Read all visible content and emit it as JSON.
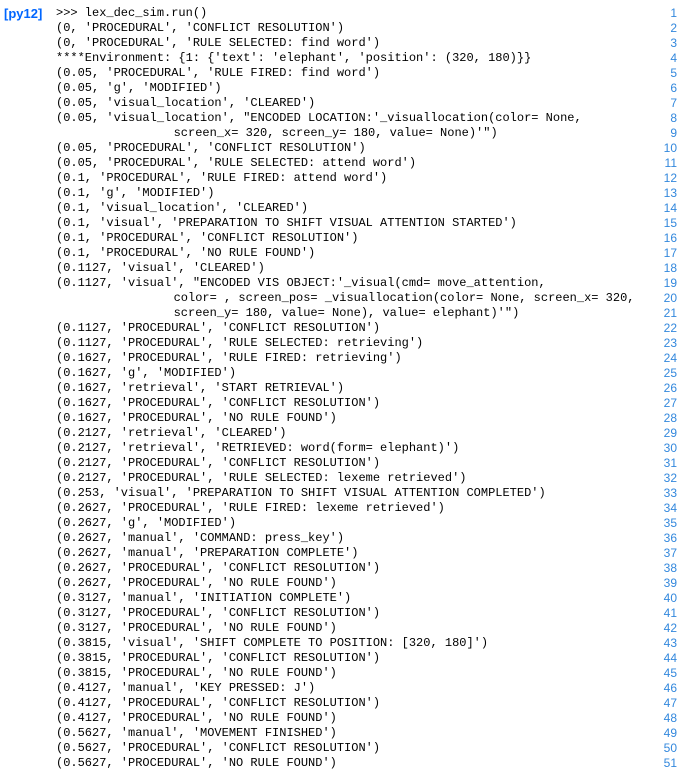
{
  "label": "[py12]",
  "lines": [
    {
      "n": "1",
      "t": ">>> lex_dec_sim.run()"
    },
    {
      "n": "2",
      "t": "(0, 'PROCEDURAL', 'CONFLICT RESOLUTION')"
    },
    {
      "n": "3",
      "t": "(0, 'PROCEDURAL', 'RULE SELECTED: find word')"
    },
    {
      "n": "4",
      "t": "****Environment: {1: {'text': 'elephant', 'position': (320, 180)}}"
    },
    {
      "n": "5",
      "t": "(0.05, 'PROCEDURAL', 'RULE FIRED: find word')"
    },
    {
      "n": "6",
      "t": "(0.05, 'g', 'MODIFIED')"
    },
    {
      "n": "7",
      "t": "(0.05, 'visual_location', 'CLEARED')"
    },
    {
      "n": "8",
      "t": "(0.05, 'visual_location', \"ENCODED LOCATION:'_visuallocation(color= None,"
    },
    {
      "n": "9",
      "t": "        screen_x= 320, screen_y= 180, value= None)'\")",
      "cont": true
    },
    {
      "n": "10",
      "t": "(0.05, 'PROCEDURAL', 'CONFLICT RESOLUTION')"
    },
    {
      "n": "11",
      "t": "(0.05, 'PROCEDURAL', 'RULE SELECTED: attend word')"
    },
    {
      "n": "12",
      "t": "(0.1, 'PROCEDURAL', 'RULE FIRED: attend word')"
    },
    {
      "n": "13",
      "t": "(0.1, 'g', 'MODIFIED')"
    },
    {
      "n": "14",
      "t": "(0.1, 'visual_location', 'CLEARED')"
    },
    {
      "n": "15",
      "t": "(0.1, 'visual', 'PREPARATION TO SHIFT VISUAL ATTENTION STARTED')"
    },
    {
      "n": "16",
      "t": "(0.1, 'PROCEDURAL', 'CONFLICT RESOLUTION')"
    },
    {
      "n": "17",
      "t": "(0.1, 'PROCEDURAL', 'NO RULE FOUND')"
    },
    {
      "n": "18",
      "t": "(0.1127, 'visual', 'CLEARED')"
    },
    {
      "n": "19",
      "t": "(0.1127, 'visual', \"ENCODED VIS OBJECT:'_visual(cmd= move_attention,"
    },
    {
      "n": "20",
      "t": "        color= , screen_pos= _visuallocation(color= None, screen_x= 320,",
      "cont": true
    },
    {
      "n": "21",
      "t": "        screen_y= 180, value= None), value= elephant)'\")",
      "cont": true
    },
    {
      "n": "22",
      "t": "(0.1127, 'PROCEDURAL', 'CONFLICT RESOLUTION')"
    },
    {
      "n": "23",
      "t": "(0.1127, 'PROCEDURAL', 'RULE SELECTED: retrieving')"
    },
    {
      "n": "24",
      "t": "(0.1627, 'PROCEDURAL', 'RULE FIRED: retrieving')"
    },
    {
      "n": "25",
      "t": "(0.1627, 'g', 'MODIFIED')"
    },
    {
      "n": "26",
      "t": "(0.1627, 'retrieval', 'START RETRIEVAL')"
    },
    {
      "n": "27",
      "t": "(0.1627, 'PROCEDURAL', 'CONFLICT RESOLUTION')"
    },
    {
      "n": "28",
      "t": "(0.1627, 'PROCEDURAL', 'NO RULE FOUND')"
    },
    {
      "n": "29",
      "t": "(0.2127, 'retrieval', 'CLEARED')"
    },
    {
      "n": "30",
      "t": "(0.2127, 'retrieval', 'RETRIEVED: word(form= elephant)')"
    },
    {
      "n": "31",
      "t": "(0.2127, 'PROCEDURAL', 'CONFLICT RESOLUTION')"
    },
    {
      "n": "32",
      "t": "(0.2127, 'PROCEDURAL', 'RULE SELECTED: lexeme retrieved')"
    },
    {
      "n": "33",
      "t": "(0.253, 'visual', 'PREPARATION TO SHIFT VISUAL ATTENTION COMPLETED')"
    },
    {
      "n": "34",
      "t": "(0.2627, 'PROCEDURAL', 'RULE FIRED: lexeme retrieved')"
    },
    {
      "n": "35",
      "t": "(0.2627, 'g', 'MODIFIED')"
    },
    {
      "n": "36",
      "t": "(0.2627, 'manual', 'COMMAND: press_key')"
    },
    {
      "n": "37",
      "t": "(0.2627, 'manual', 'PREPARATION COMPLETE')"
    },
    {
      "n": "38",
      "t": "(0.2627, 'PROCEDURAL', 'CONFLICT RESOLUTION')"
    },
    {
      "n": "39",
      "t": "(0.2627, 'PROCEDURAL', 'NO RULE FOUND')"
    },
    {
      "n": "40",
      "t": "(0.3127, 'manual', 'INITIATION COMPLETE')"
    },
    {
      "n": "41",
      "t": "(0.3127, 'PROCEDURAL', 'CONFLICT RESOLUTION')"
    },
    {
      "n": "42",
      "t": "(0.3127, 'PROCEDURAL', 'NO RULE FOUND')"
    },
    {
      "n": "43",
      "t": "(0.3815, 'visual', 'SHIFT COMPLETE TO POSITION: [320, 180]')"
    },
    {
      "n": "44",
      "t": "(0.3815, 'PROCEDURAL', 'CONFLICT RESOLUTION')"
    },
    {
      "n": "45",
      "t": "(0.3815, 'PROCEDURAL', 'NO RULE FOUND')"
    },
    {
      "n": "46",
      "t": "(0.4127, 'manual', 'KEY PRESSED: J')"
    },
    {
      "n": "47",
      "t": "(0.4127, 'PROCEDURAL', 'CONFLICT RESOLUTION')"
    },
    {
      "n": "48",
      "t": "(0.4127, 'PROCEDURAL', 'NO RULE FOUND')"
    },
    {
      "n": "49",
      "t": "(0.5627, 'manual', 'MOVEMENT FINISHED')"
    },
    {
      "n": "50",
      "t": "(0.5627, 'PROCEDURAL', 'CONFLICT RESOLUTION')"
    },
    {
      "n": "51",
      "t": "(0.5627, 'PROCEDURAL', 'NO RULE FOUND')"
    }
  ]
}
